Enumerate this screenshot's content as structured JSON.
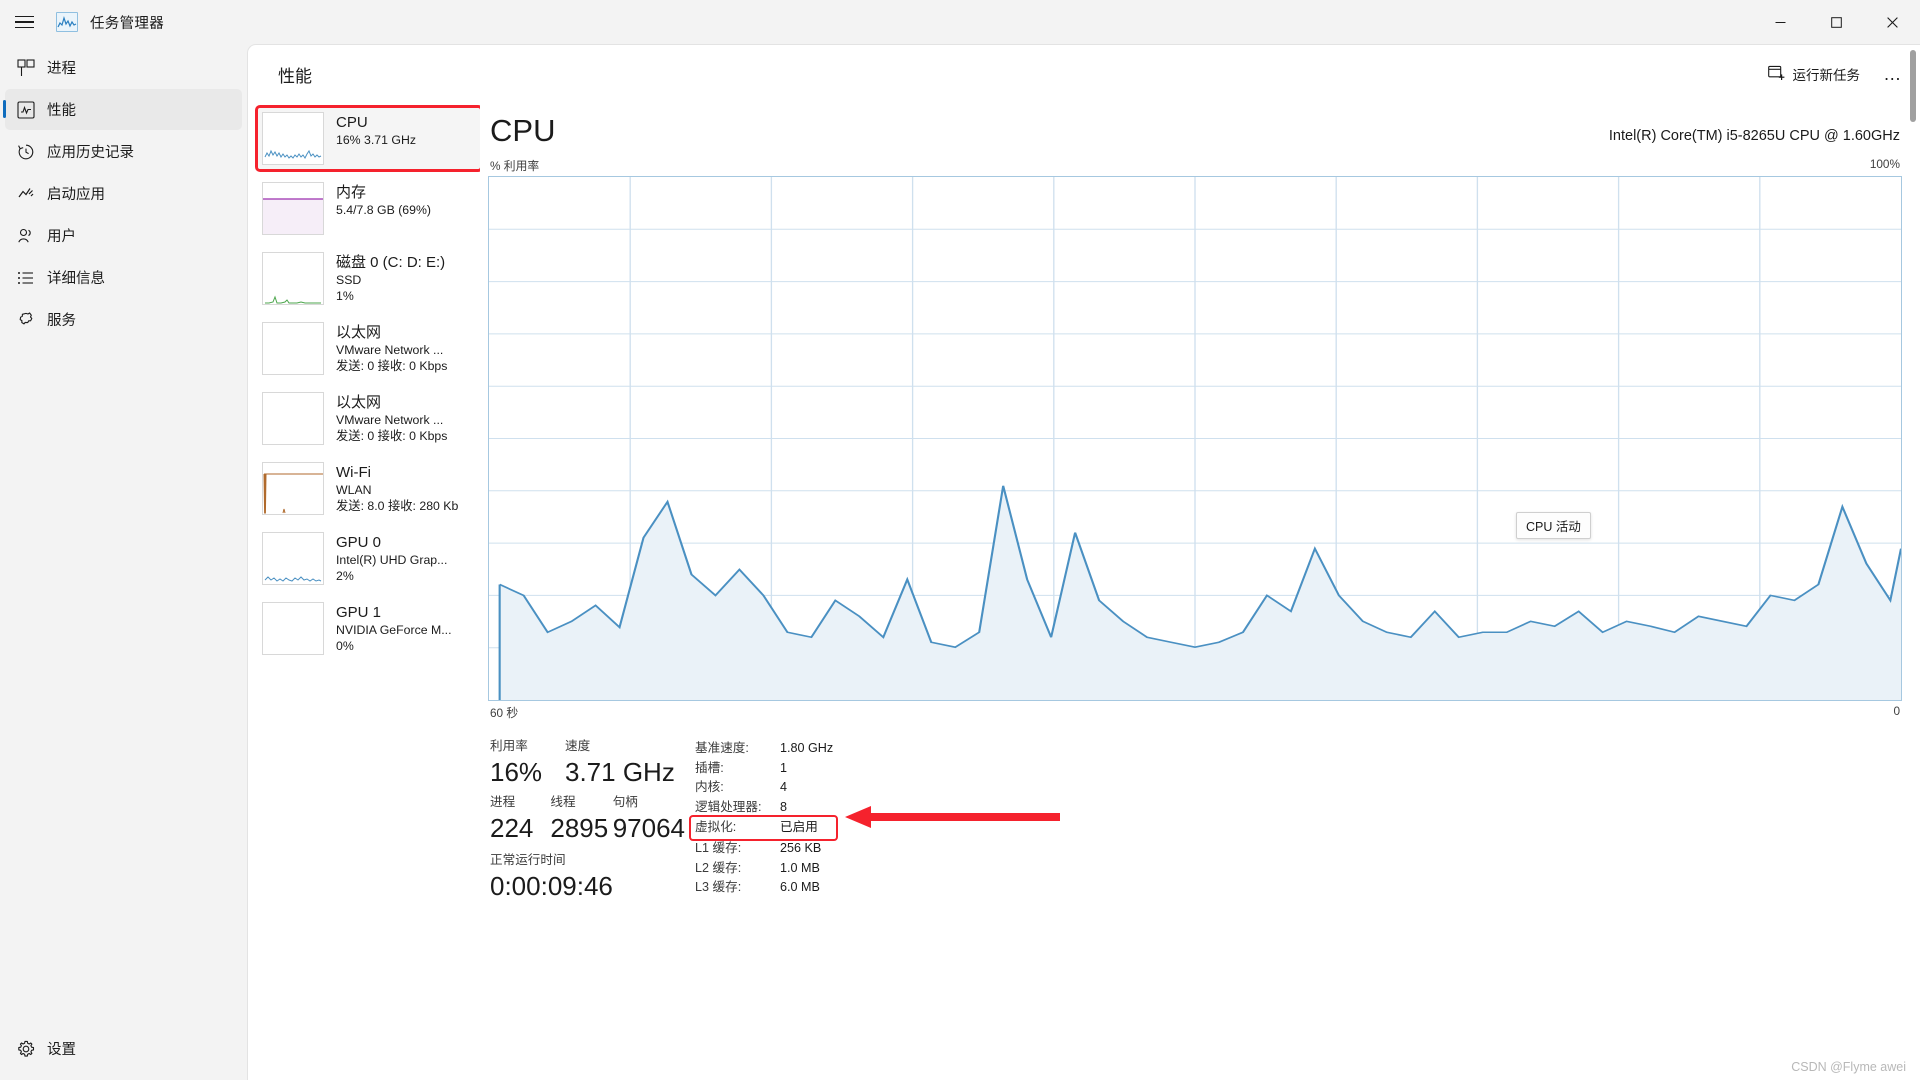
{
  "window": {
    "title": "任务管理器",
    "app_icon": "chart-icon",
    "menu_icon": "hamburger-icon",
    "minimize_label": "最小化",
    "maximize_label": "最大化",
    "close_label": "关闭"
  },
  "sidebar": {
    "items": [
      {
        "label": "进程",
        "icon": "processes-icon",
        "selected": false
      },
      {
        "label": "性能",
        "icon": "performance-icon",
        "selected": true
      },
      {
        "label": "应用历史记录",
        "icon": "history-icon",
        "selected": false
      },
      {
        "label": "启动应用",
        "icon": "startup-icon",
        "selected": false
      },
      {
        "label": "用户",
        "icon": "users-icon",
        "selected": false
      },
      {
        "label": "详细信息",
        "icon": "details-icon",
        "selected": false
      },
      {
        "label": "服务",
        "icon": "services-icon",
        "selected": false
      }
    ],
    "settings": {
      "label": "设置",
      "icon": "gear-icon"
    }
  },
  "header": {
    "title": "性能",
    "run_new_task": "运行新任务",
    "run_new_task_icon": "new-task-icon",
    "more_options": "…"
  },
  "resources": [
    {
      "name": "CPU",
      "line1": "16%  3.71 GHz",
      "line2": "",
      "selected": true,
      "annotated": true,
      "color": "#4a90c2",
      "thumb": "cpu-sparkline"
    },
    {
      "name": "内存",
      "line1": "5.4/7.8 GB (69%)",
      "line2": "",
      "selected": false,
      "annotated": false,
      "color": "#9b2fae",
      "thumb": "memory-fill"
    },
    {
      "name": "磁盘 0 (C: D: E:)",
      "line1": "SSD",
      "line2": "1%",
      "selected": false,
      "annotated": false,
      "color": "#4ca64c",
      "thumb": "disk-sparkline"
    },
    {
      "name": "以太网",
      "line1": "VMware Network ...",
      "line2": "发送: 0 接收: 0 Kbps",
      "selected": false,
      "annotated": false,
      "color": "#b06a2c",
      "thumb": "flat"
    },
    {
      "name": "以太网",
      "line1": "VMware Network ...",
      "line2": "发送: 0 接收: 0 Kbps",
      "selected": false,
      "annotated": false,
      "color": "#b06a2c",
      "thumb": "flat"
    },
    {
      "name": "Wi-Fi",
      "line1": "WLAN",
      "line2": "发送: 8.0 接收: 280 Kb",
      "selected": false,
      "annotated": false,
      "color": "#b06a2c",
      "thumb": "wifi-spike"
    },
    {
      "name": "GPU 0",
      "line1": "Intel(R) UHD Grap...",
      "line2": "2%",
      "selected": false,
      "annotated": false,
      "color": "#4a90c2",
      "thumb": "gpu0-sparkline"
    },
    {
      "name": "GPU 1",
      "line1": "NVIDIA GeForce M...",
      "line2": "0%",
      "selected": false,
      "annotated": false,
      "color": "#4a90c2",
      "thumb": "flat"
    }
  ],
  "cpu_panel": {
    "heading": "CPU",
    "model": "Intel(R) Core(TM) i5-8265U CPU @ 1.60GHz",
    "axis_top_left": "% 利用率",
    "axis_top_right": "100%",
    "axis_bottom_left": "60 秒",
    "axis_bottom_right": "0",
    "tooltip": "CPU 活动",
    "line_color": "#4a90c2",
    "fill_color": "#eaf2f8",
    "grid_color": "#cfe0ee"
  },
  "stats": {
    "utilization": {
      "label": "利用率",
      "value": "16%"
    },
    "speed": {
      "label": "速度",
      "value": "3.71 GHz"
    },
    "processes": {
      "label": "进程",
      "value": "224"
    },
    "threads": {
      "label": "线程",
      "value": "2895"
    },
    "handles": {
      "label": "句柄",
      "value": "97064"
    },
    "uptime": {
      "label": "正常运行时间",
      "value": "0:00:09:46"
    }
  },
  "details": [
    {
      "key": "基准速度:",
      "value": "1.80 GHz",
      "highlight": false
    },
    {
      "key": "插槽:",
      "value": "1",
      "highlight": false
    },
    {
      "key": "内核:",
      "value": "4",
      "highlight": false
    },
    {
      "key": "逻辑处理器:",
      "value": "8",
      "highlight": false
    },
    {
      "key": "虚拟化:",
      "value": "已启用",
      "highlight": true
    },
    {
      "key": "L1 缓存:",
      "value": "256 KB",
      "highlight": false
    },
    {
      "key": "L2 缓存:",
      "value": "1.0 MB",
      "highlight": false
    },
    {
      "key": "L3 缓存:",
      "value": "6.0 MB",
      "highlight": false
    }
  ],
  "annotations": {
    "arrow_color": "#f5222d",
    "box_color": "#f5222d"
  },
  "watermark": "CSDN @Flyme awei",
  "chart_data": {
    "type": "area",
    "title": "CPU",
    "xlabel": "60 秒",
    "ylabel": "% 利用率",
    "ylim": [
      0,
      100
    ],
    "xlim": [
      60,
      0
    ],
    "grid": true,
    "series": [
      {
        "name": "CPU 利用率",
        "values": [
          22,
          20,
          13,
          15,
          18,
          14,
          31,
          38,
          24,
          20,
          25,
          20,
          13,
          12,
          19,
          16,
          12,
          23,
          11,
          10,
          13,
          41,
          23,
          12,
          32,
          19,
          14,
          11,
          10,
          9,
          11,
          13,
          20,
          17,
          29,
          20,
          15,
          13,
          12,
          17,
          12,
          13,
          13,
          15,
          14,
          17,
          13,
          15,
          14,
          13,
          16,
          15,
          14,
          19,
          18,
          22,
          37,
          26,
          19,
          32
        ]
      }
    ]
  }
}
